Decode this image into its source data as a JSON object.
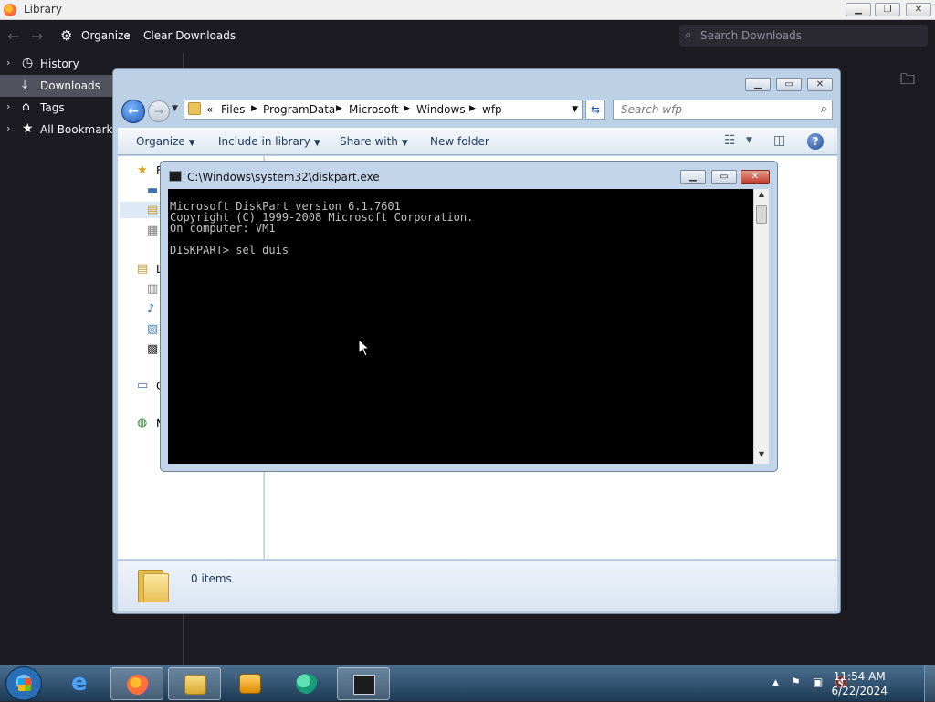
{
  "library": {
    "title": "Library",
    "toolbar": {
      "organize_label": "Organize",
      "clear_downloads_label": "Clear Downloads",
      "search_placeholder": "Search Downloads"
    },
    "sidebar": {
      "items": [
        {
          "label": "History",
          "icon": "clock-icon"
        },
        {
          "label": "Downloads",
          "icon": "download-icon",
          "selected": true
        },
        {
          "label": "Tags",
          "icon": "tag-icon"
        },
        {
          "label": "All Bookmarks",
          "icon": "star-icon"
        }
      ]
    }
  },
  "explorer": {
    "address": {
      "overflow": "«",
      "segments": [
        "Files",
        "ProgramData",
        "Microsoft",
        "Windows",
        "wfp"
      ]
    },
    "search_placeholder": "Search wfp",
    "commands": {
      "organize": "Organize",
      "include": "Include in library",
      "share": "Share with",
      "new_folder": "New folder"
    },
    "nav_letters": [
      "F",
      "L",
      "C",
      "N"
    ],
    "status": "0 items"
  },
  "console": {
    "title": "C:\\Windows\\system32\\diskpart.exe",
    "lines": [
      "Microsoft DiskPart version 6.1.7601",
      "Copyright (C) 1999-2008 Microsoft Corporation.",
      "On computer: VM1",
      "",
      "DISKPART> sel duis"
    ]
  },
  "taskbar": {
    "time": "11:54 AM",
    "date": "6/22/2024",
    "apps": [
      "internet-explorer",
      "firefox",
      "file-explorer",
      "media-player",
      "edge-beta",
      "command-prompt"
    ]
  },
  "colors": {
    "firefox_dark_bg": "#1c1b22",
    "explorer_frame": "#bcd0e6",
    "console_bg": "#000000",
    "console_fg": "#c0c0c0",
    "taskbar": "#2c4a66"
  }
}
